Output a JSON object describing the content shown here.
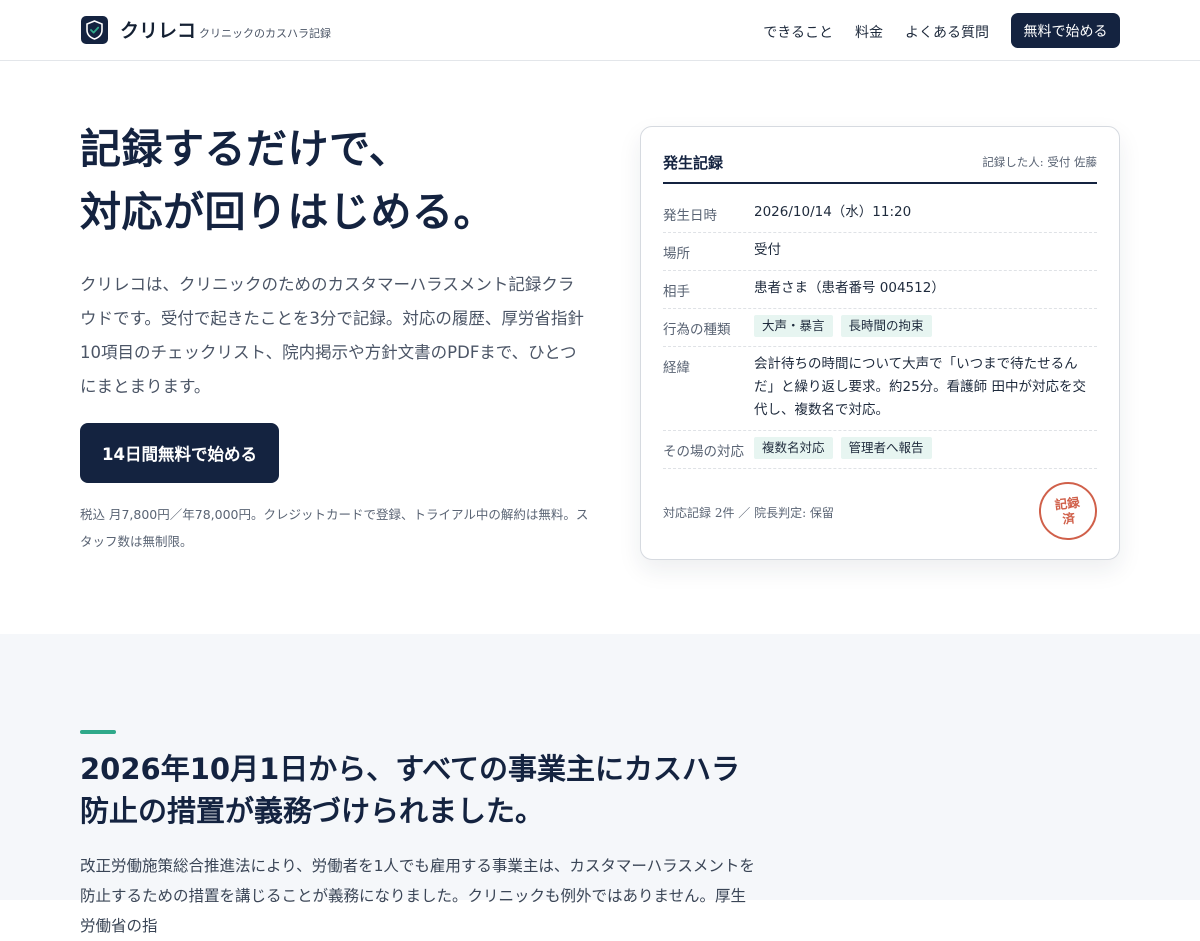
{
  "header": {
    "brand": "クリレコ",
    "tagline": "クリニックのカスハラ記録",
    "nav": [
      "できること",
      "料金",
      "よくある質問"
    ],
    "cta": "無料で始める"
  },
  "hero": {
    "title_line1": "記録するだけで、",
    "title_line2": "対応が回りはじめる。",
    "description": "クリレコは、クリニックのためのカスタマーハラスメント記録クラウドです。受付で起きたことを3分で記録。対応の履歴、厚労省指針10項目のチェックリスト、院内掲示や方針文書のPDFまで、ひとつにまとまります。",
    "cta": "14日間無料で始める",
    "price_note": "税込 月7,800円／年78,000円。クレジットカードで登録、トライアル中の解約は無料。スタッフ数は無制限。"
  },
  "card": {
    "title": "発生記録",
    "recorder": "記録した人: 受付 佐藤",
    "rows": [
      {
        "label": "発生日時",
        "value": "2026/10/14（水）11:20"
      },
      {
        "label": "場所",
        "value": "受付"
      },
      {
        "label": "相手",
        "value": "患者さま（患者番号 004512）"
      },
      {
        "label": "行為の種類",
        "tags": [
          "大声・暴言",
          "長時間の拘束"
        ]
      },
      {
        "label": "経緯",
        "value": "会計待ちの時間について大声で「いつまで待たせるんだ」と繰り返し要求。約25分。看護師 田中が対応を交代し、複数名で対応。"
      },
      {
        "label": "その場の対応",
        "tags": [
          "複数名対応",
          "管理者へ報告"
        ]
      }
    ],
    "footer": "対応記録 2件 ／ 院長判定: 保留",
    "stamp_line1": "記録",
    "stamp_line2": "済"
  },
  "section2": {
    "title": "2026年10月1日から、すべての事業主にカスハラ防止の措置が義務づけられました。",
    "body": "改正労働施策総合推進法により、労働者を1人でも雇用する事業主は、カスタマーハラスメントを防止するための措置を講じることが義務になりました。クリニックも例外ではありません。厚生労働省の指"
  },
  "colors": {
    "navy": "#142340",
    "accent": "#2fa98a",
    "tag_bg": "#e7f5f1",
    "stamp": "#d0604a"
  }
}
